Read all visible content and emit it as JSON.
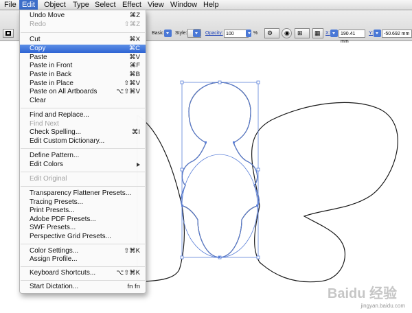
{
  "menubar": {
    "items": [
      {
        "label": "File",
        "active": false
      },
      {
        "label": "Edit",
        "active": true
      },
      {
        "label": "Object",
        "active": false
      },
      {
        "label": "Type",
        "active": false
      },
      {
        "label": "Select",
        "active": false
      },
      {
        "label": "Effect",
        "active": false
      },
      {
        "label": "View",
        "active": false
      },
      {
        "label": "Window",
        "active": false
      },
      {
        "label": "Help",
        "active": false
      }
    ]
  },
  "controlbar": {
    "brush_label": "Basic",
    "style_label": "Style:",
    "opacity_label": "Opacity:",
    "opacity_value": "100",
    "opacity_unit": "%",
    "x_label": "X:",
    "x_value": "190.41 mm",
    "y_label": "Y:",
    "y_value": "-50.692 mm"
  },
  "edit_menu": {
    "items": [
      {
        "label": "Undo Move",
        "shortcut": "⌘Z",
        "disabled": false
      },
      {
        "label": "Redo",
        "shortcut": "⇧⌘Z",
        "disabled": true
      },
      {
        "separator": true
      },
      {
        "label": "Cut",
        "shortcut": "⌘X",
        "disabled": false
      },
      {
        "label": "Copy",
        "shortcut": "⌘C",
        "disabled": false,
        "highlighted": true
      },
      {
        "label": "Paste",
        "shortcut": "⌘V",
        "disabled": false
      },
      {
        "label": "Paste in Front",
        "shortcut": "⌘F",
        "disabled": false
      },
      {
        "label": "Paste in Back",
        "shortcut": "⌘B",
        "disabled": false
      },
      {
        "label": "Paste in Place",
        "shortcut": "⇧⌘V",
        "disabled": false
      },
      {
        "label": "Paste on All Artboards",
        "shortcut": "⌥⇧⌘V",
        "disabled": false
      },
      {
        "label": "Clear",
        "shortcut": "",
        "disabled": false
      },
      {
        "separator": true
      },
      {
        "label": "Find and Replace...",
        "shortcut": "",
        "disabled": false
      },
      {
        "label": "Find Next",
        "shortcut": "",
        "disabled": true
      },
      {
        "label": "Check Spelling...",
        "shortcut": "⌘I",
        "disabled": false
      },
      {
        "label": "Edit Custom Dictionary...",
        "shortcut": "",
        "disabled": false
      },
      {
        "separator": true
      },
      {
        "label": "Define Pattern...",
        "shortcut": "",
        "disabled": false
      },
      {
        "label": "Edit Colors",
        "shortcut": "",
        "disabled": false,
        "submenu": true
      },
      {
        "separator": true
      },
      {
        "label": "Edit Original",
        "shortcut": "",
        "disabled": true
      },
      {
        "separator": true
      },
      {
        "label": "Transparency Flattener Presets...",
        "shortcut": "",
        "disabled": false
      },
      {
        "label": "Tracing Presets...",
        "shortcut": "",
        "disabled": false
      },
      {
        "label": "Print Presets...",
        "shortcut": "",
        "disabled": false
      },
      {
        "label": "Adobe PDF Presets...",
        "shortcut": "",
        "disabled": false
      },
      {
        "label": "SWF Presets...",
        "shortcut": "",
        "disabled": false
      },
      {
        "label": "Perspective Grid Presets...",
        "shortcut": "",
        "disabled": false
      },
      {
        "separator": true
      },
      {
        "label": "Color Settings...",
        "shortcut": "⇧⌘K",
        "disabled": false
      },
      {
        "label": "Assign Profile...",
        "shortcut": "",
        "disabled": false
      },
      {
        "separator": true
      },
      {
        "label": "Keyboard Shortcuts...",
        "shortcut": "⌥⇧⌘K",
        "disabled": false
      },
      {
        "separator": true
      },
      {
        "label": "Start Dictation...",
        "shortcut": "fn fn",
        "disabled": false
      }
    ]
  },
  "watermark": {
    "logo": "Baidu 经验",
    "url": "jingyan.baidu.com"
  },
  "colors": {
    "highlight": "#2e64d3",
    "selection": "#4a6fd8",
    "stroke": "#1a1a1a"
  }
}
